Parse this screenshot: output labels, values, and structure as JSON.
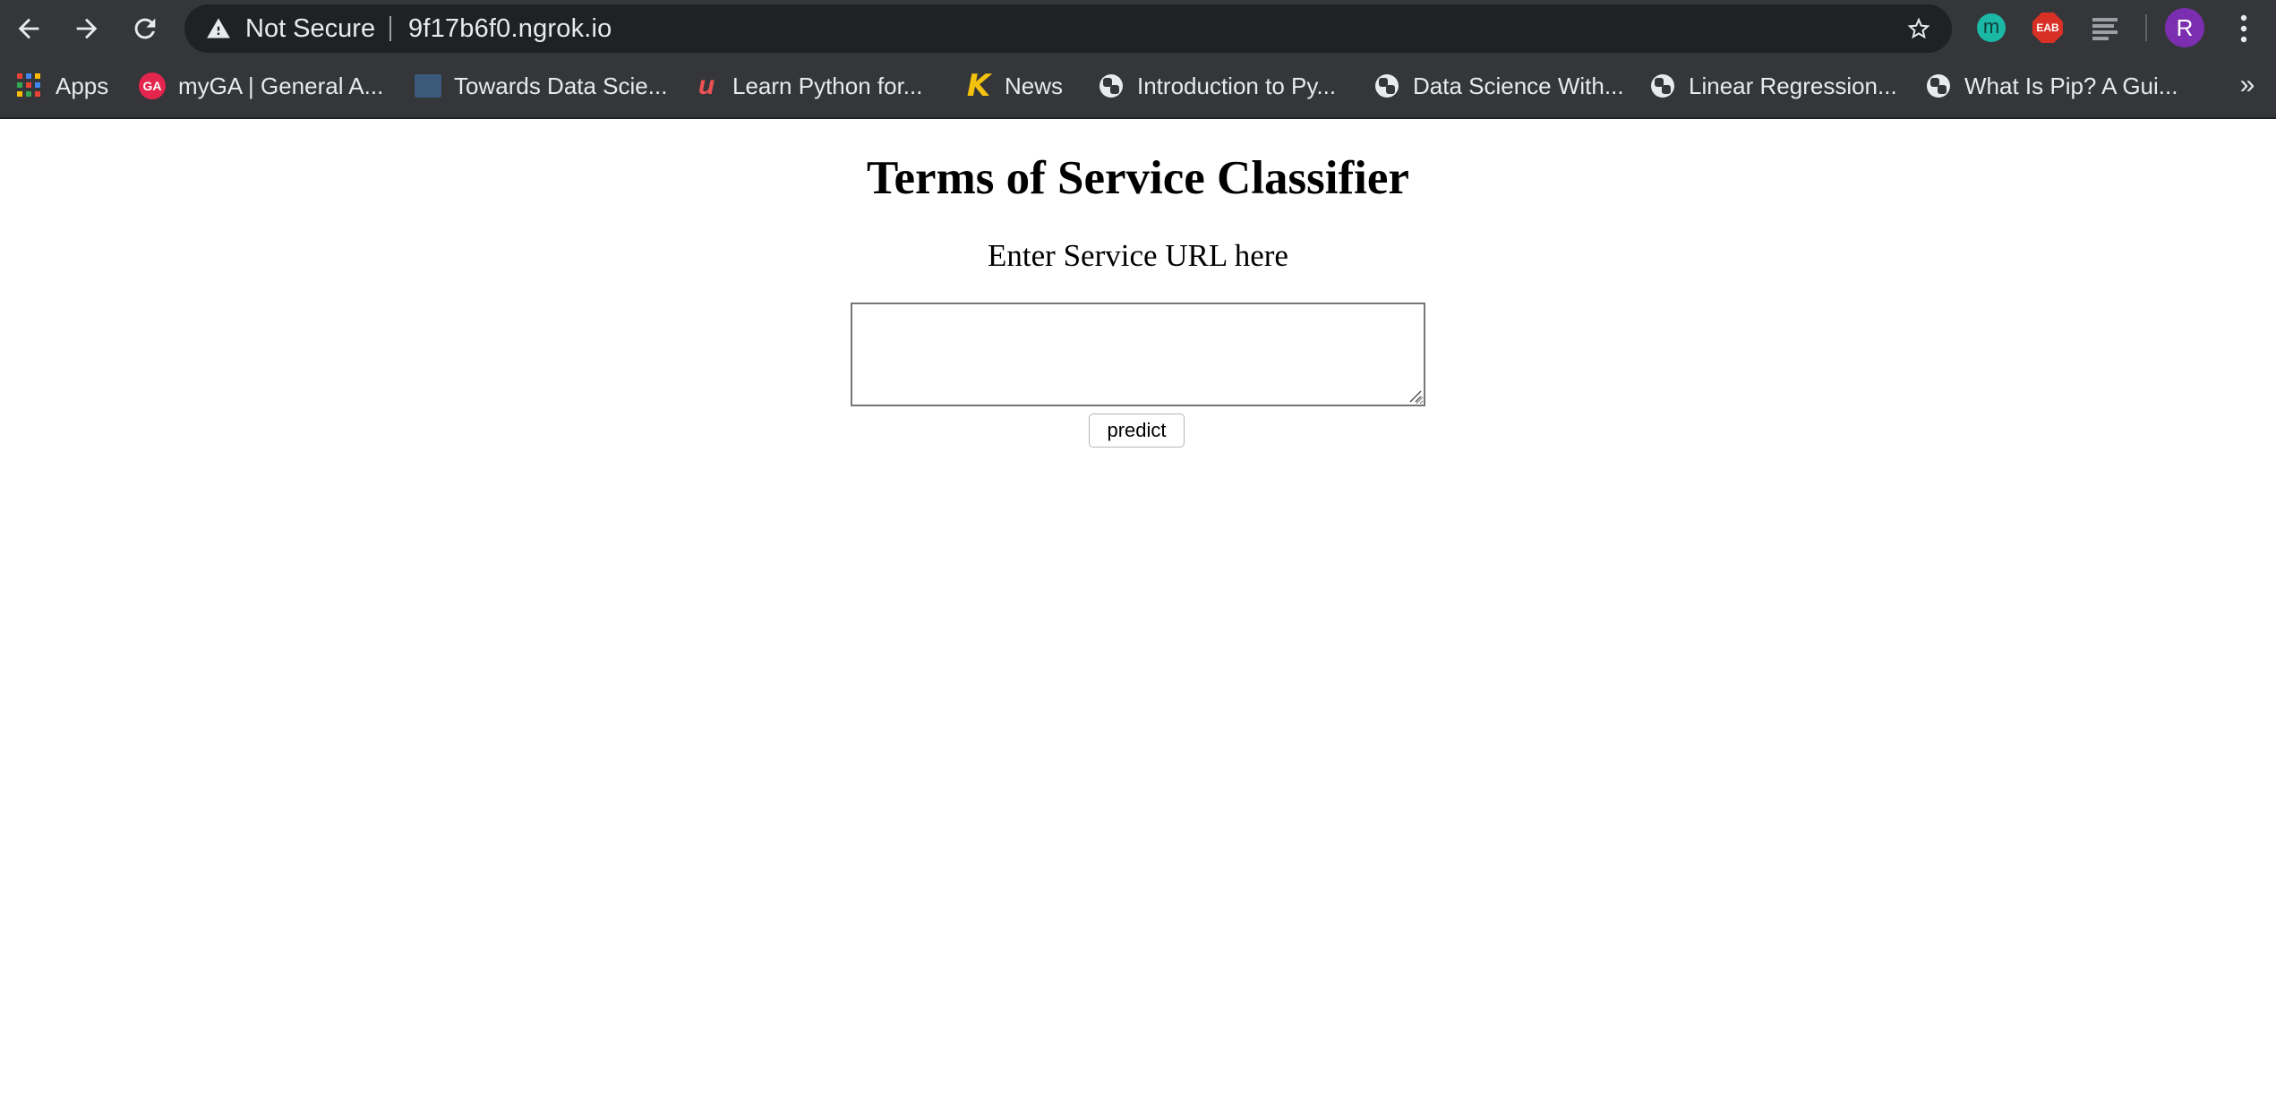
{
  "browser": {
    "omnibox": {
      "security_label": "Not Secure",
      "url": "9f17b6f0.ngrok.io"
    },
    "profile_initial": "R",
    "extensions": [
      {
        "icon": "m-extension-icon",
        "label": "m",
        "color": "#1cb8a6"
      },
      {
        "icon": "eab-extension-icon",
        "label": "EAB",
        "color": "#d93025"
      },
      {
        "icon": "lines-extension-icon"
      }
    ],
    "bookmarks": [
      {
        "label": "Apps",
        "icon": "apps-grid-icon"
      },
      {
        "label": "myGA | General A...",
        "icon": "ga-icon",
        "icon_text": "GA"
      },
      {
        "label": "Towards Data Scie...",
        "icon": "towards-data-science-icon"
      },
      {
        "label": "Learn Python for...",
        "icon": "udemy-icon",
        "icon_text": "u"
      },
      {
        "label": "News",
        "icon": "k-icon",
        "icon_text": "K"
      },
      {
        "label": "Introduction to Py...",
        "icon": "python-icon"
      },
      {
        "label": "Data Science With...",
        "icon": "python-icon"
      },
      {
        "label": "Linear Regression...",
        "icon": "python-icon"
      },
      {
        "label": "What Is Pip? A Gui...",
        "icon": "python-icon"
      }
    ],
    "bookmarks_overflow": "»"
  },
  "page": {
    "title": "Terms of Service Classifier",
    "subtitle": "Enter Service URL here",
    "input": {
      "value": "",
      "placeholder": ""
    },
    "submit_label": "predict"
  },
  "colors": {
    "chrome_bg": "#35363a",
    "omnibox_bg": "#202124",
    "profile_avatar": "#7b2fb0"
  }
}
